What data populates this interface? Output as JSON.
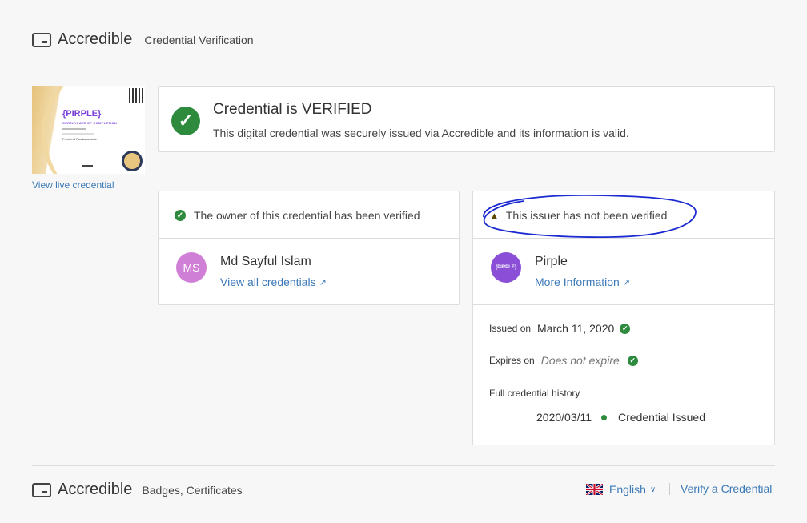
{
  "header": {
    "brand": "Accredible",
    "subtitle": "Credential Verification"
  },
  "certificate": {
    "logo_text": "{PIRPLE}",
    "title_text": "CERTIFICATE OF COMPLETION",
    "course_text": "Frontend Fundamentals",
    "view_link": "View live credential"
  },
  "verified_banner": {
    "title": "Credential is VERIFIED",
    "description": "This digital credential was securely issued via Accredible and its information is valid."
  },
  "owner_card": {
    "status": "The owner of this credential has been verified",
    "initials": "MS",
    "name": "Md Sayful Islam",
    "link": "View all credentials"
  },
  "issuer_card": {
    "status": "This issuer has not been verified",
    "logo_text": "{PIRPLE}",
    "name": "Pirple",
    "link": "More Information",
    "issued_label": "Issued on",
    "issued_value": "March 11, 2020",
    "expires_label": "Expires on",
    "expires_value": "Does not expire",
    "history_label": "Full credential history",
    "history_date": "2020/03/11",
    "history_event": "Credential Issued"
  },
  "footer": {
    "brand": "Accredible",
    "subtitle": "Badges, Certificates",
    "language": "English",
    "verify_link": "Verify a Credential"
  },
  "colors": {
    "green": "#2e8b3e",
    "link_blue": "#3b79b8",
    "owner_avatar": "#d07fd6",
    "issuer_avatar": "#8a4fd6",
    "annotation_blue": "#1a2ad0"
  }
}
